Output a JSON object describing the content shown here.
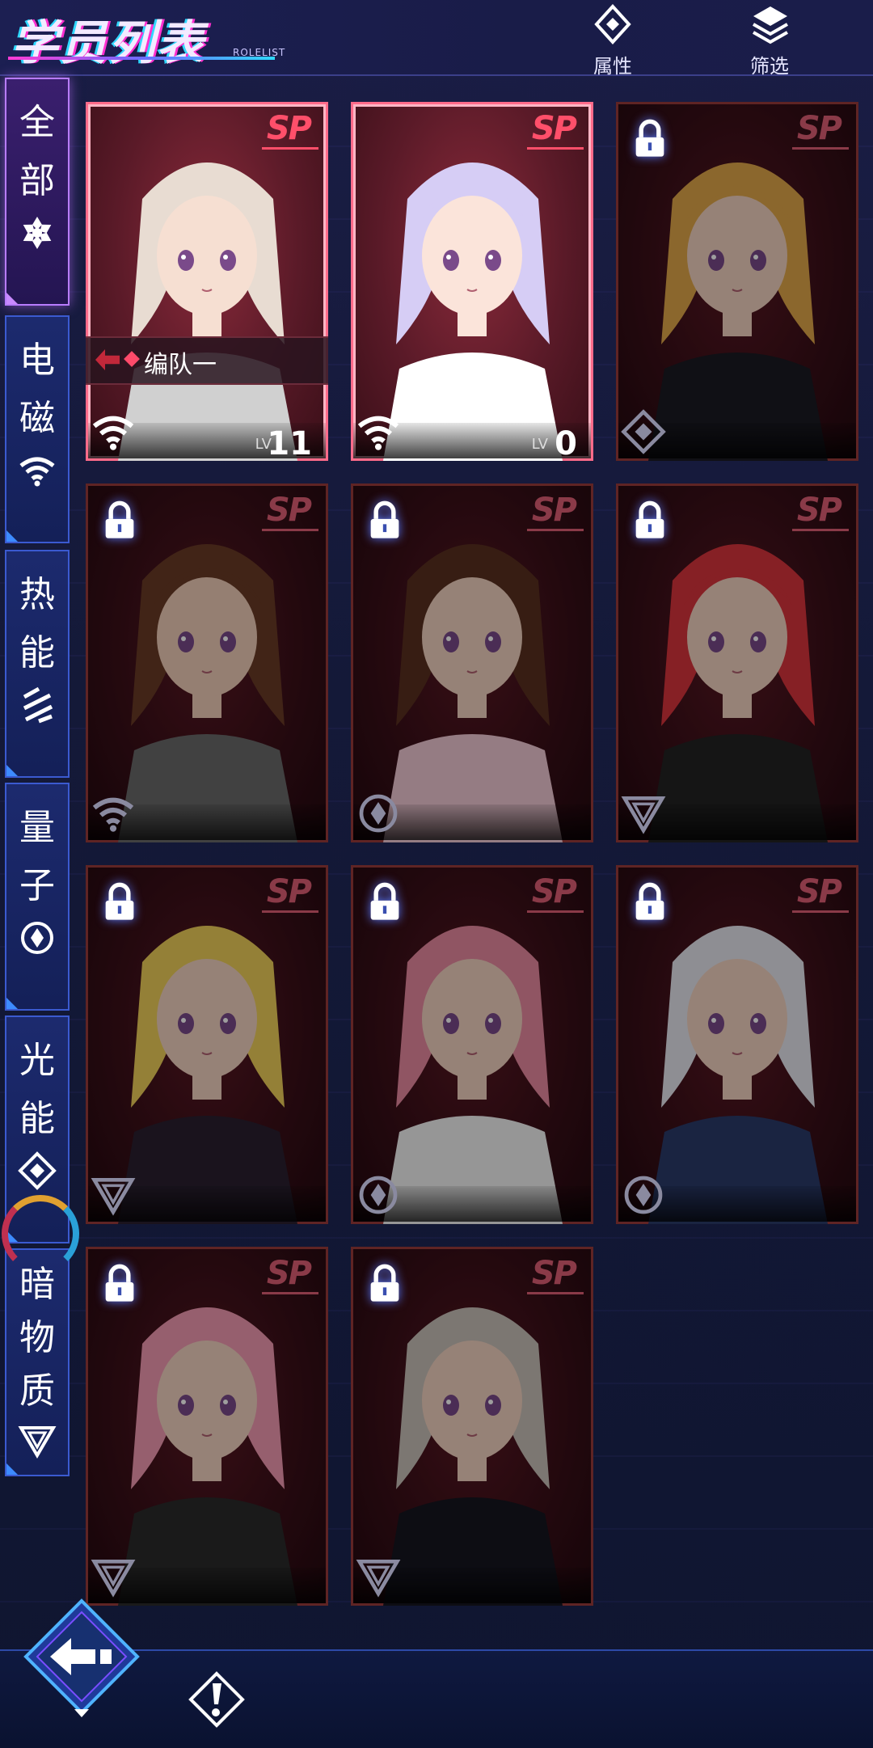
{
  "header": {
    "title": "学员列表",
    "subtitle": "ROLELIST",
    "attr_button": "属性",
    "filter_button": "筛选"
  },
  "sidebar": {
    "tabs": [
      {
        "label": "全部",
        "chars": [
          "全",
          "部"
        ],
        "icon": "all-icon",
        "active": true
      },
      {
        "label": "电磁",
        "chars": [
          "电",
          "磁"
        ],
        "icon": "wifi-icon",
        "active": false
      },
      {
        "label": "热能",
        "chars": [
          "热",
          "能"
        ],
        "icon": "thermal-icon",
        "active": false
      },
      {
        "label": "量子",
        "chars": [
          "量",
          "子"
        ],
        "icon": "quantum-icon",
        "active": false
      },
      {
        "label": "光能",
        "chars": [
          "光",
          "能"
        ],
        "icon": "light-diamond-icon",
        "active": false
      },
      {
        "label": "暗物质",
        "chars": [
          "暗",
          "物",
          "质"
        ],
        "icon": "dark-triangle-icon",
        "active": false
      }
    ]
  },
  "cards": [
    {
      "rank": "SP",
      "locked": false,
      "attr_icon": "wifi-icon",
      "lv_label": "LV",
      "level": "11",
      "team": "编队一",
      "hair": "#e8dcd2",
      "skin": "#f6dfd2",
      "outfit": "#d0d0d0"
    },
    {
      "rank": "SP",
      "locked": false,
      "attr_icon": "wifi-icon",
      "lv_label": "LV",
      "level": "0",
      "team": "",
      "hair": "#d6cdf5",
      "skin": "#fbe4da",
      "outfit": "#ffffff"
    },
    {
      "rank": "SP",
      "locked": true,
      "attr_icon": "light-diamond-icon",
      "hair": "#e0a64a",
      "skin": "#f3d2c0",
      "outfit": "#1a1a22"
    },
    {
      "rank": "SP",
      "locked": true,
      "attr_icon": "wifi-icon",
      "hair": "#6a3a26",
      "skin": "#f0cdb8",
      "outfit": "#6a6a6a"
    },
    {
      "rank": "SP",
      "locked": true,
      "attr_icon": "quantum-icon",
      "hair": "#5a3020",
      "skin": "#f3d2c0",
      "outfit": "#f1c9d4"
    },
    {
      "rank": "SP",
      "locked": true,
      "attr_icon": "dark-triangle-icon",
      "hair": "#d8343c",
      "skin": "#f3d2c0",
      "outfit": "#222222"
    },
    {
      "rank": "SP",
      "locked": true,
      "attr_icon": "dark-triangle-icon",
      "hair": "#efcf5a",
      "skin": "#f3d2c0",
      "outfit": "#2a2030"
    },
    {
      "rank": "SP",
      "locked": true,
      "attr_icon": "quantum-icon",
      "hair": "#e88aa0",
      "skin": "#f3d2c0",
      "outfit": "#f2f2f2"
    },
    {
      "rank": "SP",
      "locked": true,
      "attr_icon": "quantum-icon",
      "hair": "#e6e6ee",
      "skin": "#f3d2c0",
      "outfit": "#2a3a6a"
    },
    {
      "rank": "SP",
      "locked": true,
      "attr_icon": "dark-triangle-icon",
      "hair": "#f29ab2",
      "skin": "#f3d2c0",
      "outfit": "#2a2a2a"
    },
    {
      "rank": "SP",
      "locked": true,
      "attr_icon": "dark-triangle-icon",
      "hair": "#c9c0b8",
      "skin": "#f3d2c0",
      "outfit": "#15151f"
    }
  ],
  "colors": {
    "accent_pink": "#ff4f6a",
    "accent_purple": "#b87cff",
    "accent_blue": "#3d8bff"
  }
}
